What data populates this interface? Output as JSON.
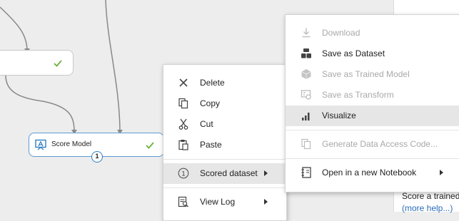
{
  "canvas": {
    "modules": {
      "upper": {
        "label": ""
      },
      "score": {
        "label": "Score Model",
        "output_port": "1"
      }
    }
  },
  "context_menu": {
    "items": [
      {
        "label": "Delete",
        "icon": "close-icon"
      },
      {
        "label": "Copy",
        "icon": "copy-icon"
      },
      {
        "label": "Cut",
        "icon": "scissors-icon"
      },
      {
        "label": "Paste",
        "icon": "paste-icon"
      },
      {
        "label": "Scored dataset",
        "icon": "port-number-icon",
        "port_number": "1",
        "has_submenu": true
      },
      {
        "label": "View Log",
        "icon": "view-log-icon",
        "has_submenu": true
      }
    ]
  },
  "submenu": {
    "items": [
      {
        "label": "Download",
        "icon": "download-icon",
        "disabled": true
      },
      {
        "label": "Save as Dataset",
        "icon": "save-dataset-icon",
        "disabled": false
      },
      {
        "label": "Save as Trained Model",
        "icon": "trained-model-icon",
        "disabled": true
      },
      {
        "label": "Save as Transform",
        "icon": "transform-icon",
        "disabled": true
      },
      {
        "label": "Visualize",
        "icon": "bar-chart-icon",
        "disabled": false
      },
      {
        "label": "Generate Data Access Code...",
        "icon": "data-access-code-icon",
        "disabled": true
      },
      {
        "label": "Open in a new Notebook",
        "icon": "notebook-icon",
        "disabled": false,
        "has_submenu": true
      }
    ]
  },
  "properties_panel": {
    "description": "Score a trained",
    "help_link": "(more help...)"
  },
  "colors": {
    "canvas_bg": "#ededed",
    "check_green": "#6cb33e",
    "port_blue": "#2f7fc1",
    "link_blue": "#2b6cb8",
    "disabled_text": "#a9a9a9"
  }
}
